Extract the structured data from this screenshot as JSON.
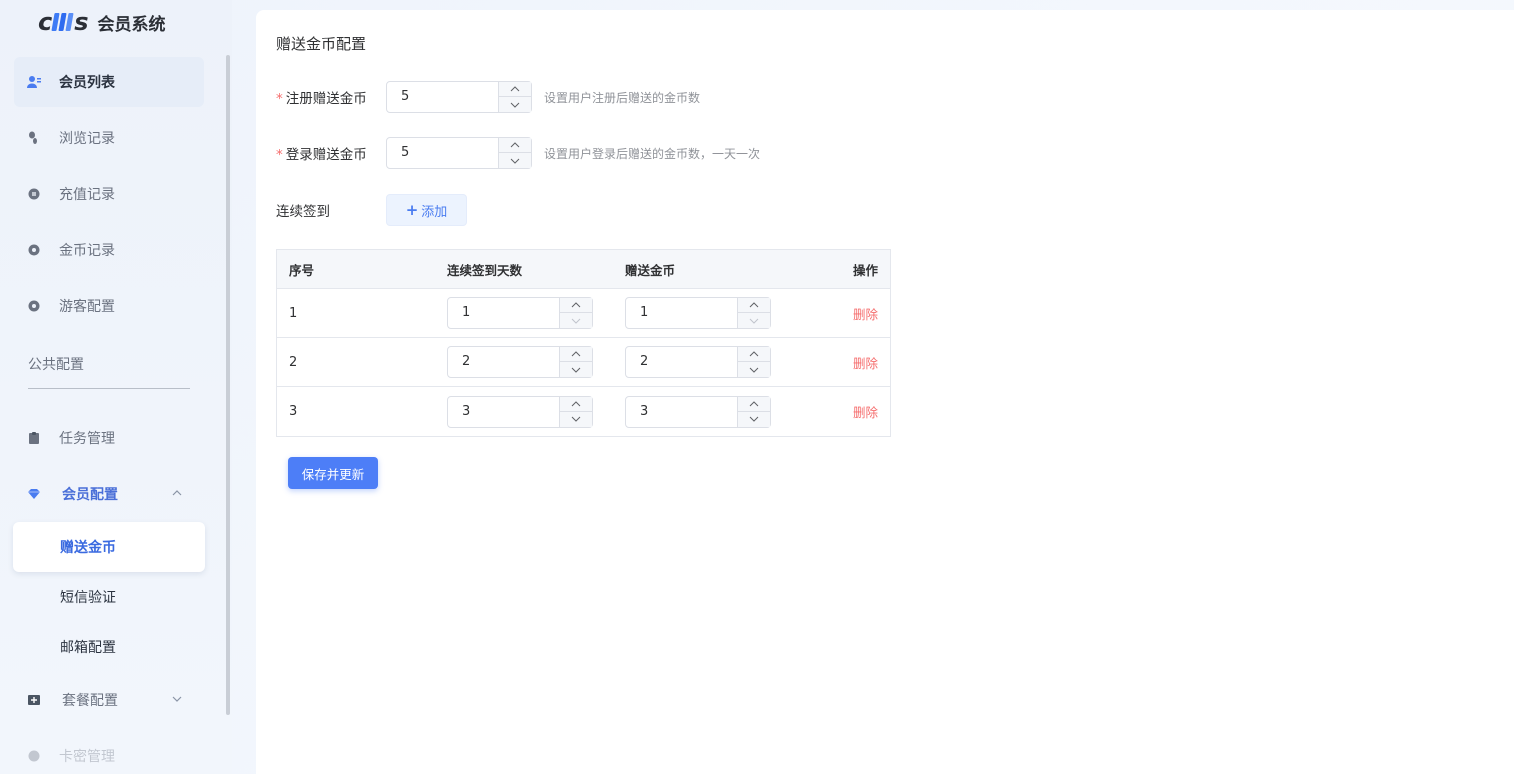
{
  "app": {
    "title": "会员系统"
  },
  "sidebar": {
    "items": [
      {
        "label": "会员列表",
        "icon": "users-icon"
      },
      {
        "label": "浏览记录",
        "icon": "footprint-icon"
      },
      {
        "label": "充值记录",
        "icon": "record-icon"
      },
      {
        "label": "金币记录",
        "icon": "coin-icon"
      },
      {
        "label": "游客配置",
        "icon": "guest-icon"
      }
    ],
    "section_label": "公共配置",
    "task": {
      "label": "任务管理",
      "icon": "clipboard-icon"
    },
    "member_config": {
      "label": "会员配置",
      "icon": "diamond-icon",
      "children": [
        "赠送金币",
        "短信验证",
        "邮箱配置"
      ]
    },
    "package": {
      "label": "套餐配置",
      "icon": "package-icon"
    },
    "card": {
      "label": "卡密管理",
      "icon": "card-icon"
    }
  },
  "main": {
    "title": "赠送金币配置",
    "register": {
      "label": "注册赠送金币",
      "value": "5",
      "hint": "设置用户注册后赠送的金币数"
    },
    "login": {
      "label": "登录赠送金币",
      "value": "5",
      "hint": "设置用户登录后赠送的金币数，一天一次"
    },
    "checkin": {
      "label": "连续签到",
      "add_label": "添加"
    },
    "table": {
      "headers": [
        "序号",
        "连续签到天数",
        "赠送金币",
        "操作"
      ],
      "rows": [
        {
          "index": "1",
          "days": "1",
          "coins": "1",
          "action": "删除"
        },
        {
          "index": "2",
          "days": "2",
          "coins": "2",
          "action": "删除"
        },
        {
          "index": "3",
          "days": "3",
          "coins": "3",
          "action": "删除"
        }
      ]
    },
    "save_label": "保存并更新"
  },
  "colors": {
    "primary": "#4d7ef7",
    "danger": "#f56c6c",
    "active_text": "#3a6ae0"
  }
}
